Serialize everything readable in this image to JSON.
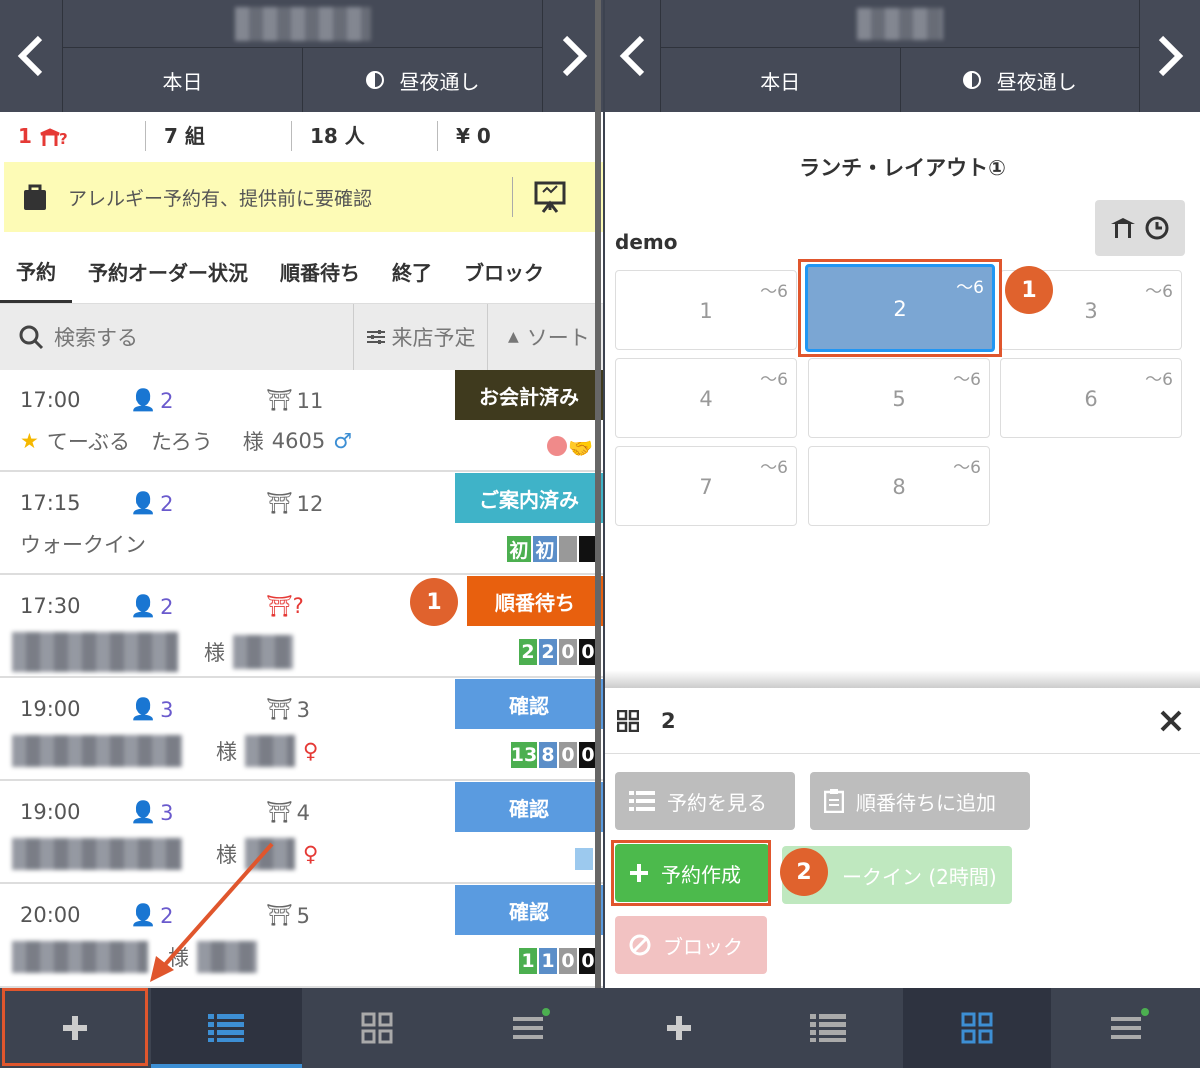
{
  "left": {
    "header": {
      "tabs": [
        "本日",
        "昼夜通し"
      ]
    },
    "stats": {
      "unassigned": "1",
      "groups": "7 組",
      "people": "18 人",
      "amount": "¥ 0"
    },
    "notice": "アレルギー予約有、提供前に要確認",
    "tabs": [
      "予約",
      "予約オーダー状況",
      "順番待ち",
      "終了",
      "ブロック"
    ],
    "search": {
      "placeholder": "検索する",
      "filter": "来店予定",
      "sort": "ソート"
    },
    "reservations": [
      {
        "time": "17:00",
        "people": "2",
        "table": "11",
        "name": "てーぶる　たろう",
        "suffix": "様",
        "code": "4605",
        "status": "お会計済み",
        "status_color": "#3f3a1e"
      },
      {
        "time": "17:15",
        "people": "2",
        "table": "12",
        "name": "ウォークイン",
        "status": "ご案内済み",
        "status_color": "#3fb3c8",
        "tags": [
          "初",
          "初"
        ]
      },
      {
        "time": "17:30",
        "people": "2",
        "table": "",
        "suffix": "様",
        "status": "順番待ち",
        "status_color": "#e8600e",
        "nums": [
          "2",
          "2",
          "0",
          "0"
        ],
        "step": "1"
      },
      {
        "time": "19:00",
        "people": "3",
        "table": "3",
        "suffix": "様",
        "status": "確認",
        "status_color": "#5a9be0",
        "nums": [
          "13",
          "8",
          "0",
          "0"
        ]
      },
      {
        "time": "19:00",
        "people": "3",
        "table": "4",
        "suffix": "様",
        "status": "確認",
        "status_color": "#5a9be0"
      },
      {
        "time": "20:00",
        "people": "2",
        "table": "5",
        "suffix": "様",
        "status": "確認",
        "status_color": "#5a9be0",
        "nums": [
          "1",
          "1",
          "0",
          "0"
        ]
      }
    ]
  },
  "right": {
    "header": {
      "tabs": [
        "本日",
        "昼夜通し"
      ]
    },
    "layout_title": "ランチ・レイアウト①",
    "area": "demo",
    "tables": [
      {
        "label": "1",
        "capacity": "～6"
      },
      {
        "label": "2",
        "capacity": "～6"
      },
      {
        "label": "3",
        "capacity": "～6"
      },
      {
        "label": "4",
        "capacity": "～6"
      },
      {
        "label": "5",
        "capacity": "～6"
      },
      {
        "label": "6",
        "capacity": "～6"
      },
      {
        "label": "7",
        "capacity": "～6"
      },
      {
        "label": "8",
        "capacity": "～6"
      }
    ],
    "step1": "1",
    "step2": "2",
    "dialog": {
      "table": "2",
      "view_reservations": "予約を見る",
      "add_waitlist": "順番待ちに追加",
      "create_reservation": "予約作成",
      "walkin": "ークイン (2時間)",
      "block": "ブロック"
    }
  },
  "colors": {
    "header": "#454a57",
    "accent_orange": "#e0622d",
    "selected_table": "#7ba6d3",
    "create_btn": "#4cba4c"
  }
}
